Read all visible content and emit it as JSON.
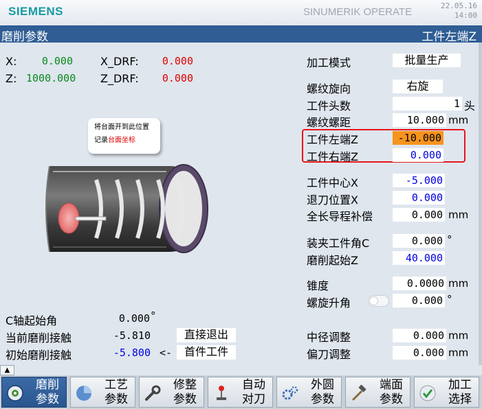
{
  "header": {
    "brand": "SIEMENS",
    "product": "SINUMERIK OPERATE",
    "date": "22.05.16",
    "time": "14:00"
  },
  "titlebar": {
    "left": "磨削参数",
    "right": "工件左端Z"
  },
  "axes": {
    "x_label": "X:",
    "x_value": "0.000",
    "z_label": "Z:",
    "z_value": "1000.000",
    "xdrf_label": "X_DRF:",
    "xdrf_value": "0.000",
    "zdrf_label": "Z_DRF:",
    "zdrf_value": "0.000"
  },
  "callout": {
    "line1": "将台面开到此位置",
    "line2_prefix": "记录",
    "line2_highlight": "台面坐标"
  },
  "params": {
    "mode_label": "加工模式",
    "mode_value": "批量生产",
    "thread_dir_label": "螺纹旋向",
    "thread_dir_value": "右旋",
    "thread_starts_label": "工件头数",
    "thread_starts_value": "1",
    "thread_starts_unit": "头",
    "pitch_label": "螺纹螺距",
    "pitch_value": "10.000",
    "pitch_unit": "mm",
    "left_end_label": "工件左端Z",
    "left_end_value": "-10.000",
    "right_end_label": "工件右端Z",
    "right_end_value": "0.000",
    "center_x_label": "工件中心X",
    "center_x_value": "-5.000",
    "retract_x_label": "退刀位置X",
    "retract_x_value": "0.000",
    "lead_comp_label": "全长导程补偿",
    "lead_comp_value": "0.000",
    "lead_comp_unit": "mm",
    "clamp_angle_label": "装夹工件角C",
    "clamp_angle_value": "0.000",
    "clamp_angle_unit": "°",
    "grind_start_label": "磨削起始Z",
    "grind_start_value": "40.000",
    "taper_label": "锥度",
    "taper_value": "0.0000",
    "taper_unit": "mm",
    "helix_label": "螺旋升角",
    "helix_value": "0.000",
    "helix_unit": "°",
    "pitch_dia_label": "中径调整",
    "pitch_dia_value": "0.000",
    "pitch_dia_unit": "mm",
    "offset_label": "偏刀调整",
    "offset_value": "0.000",
    "offset_unit": "mm"
  },
  "bottom_left": {
    "c_start_label": "C轴起始角",
    "c_start_value": "0.000",
    "c_start_unit": "°",
    "cur_contact_label": "当前磨削接触",
    "cur_contact_value": "-5.810",
    "exit_button": "直接退出",
    "init_contact_label": "初始磨削接触",
    "init_contact_value": "-5.800",
    "arrow": "<-",
    "first_piece_button": "首件工件"
  },
  "softkeys": [
    {
      "label": "磨削\n参数",
      "icon": "grinding-wheel-icon",
      "active": true
    },
    {
      "label": "工艺\n参数",
      "icon": "pie-chart-icon",
      "active": false
    },
    {
      "label": "修整\n参数",
      "icon": "wrench-icon",
      "active": false
    },
    {
      "label": "自动\n对刀",
      "icon": "joystick-icon",
      "active": false
    },
    {
      "label": "外圆\n参数",
      "icon": "gears-icon",
      "active": false
    },
    {
      "label": "端面\n参数",
      "icon": "hammer-icon",
      "active": false
    },
    {
      "label": "加工\n选择",
      "icon": "checkmark-icon",
      "active": false
    }
  ],
  "colors": {
    "brand": "#179aa3",
    "titlebar": "#2f5d94",
    "highlight_field": "#f7941d",
    "frame": "#e8151b",
    "value_blue": "#0000e0",
    "value_green": "#0a8a1e",
    "value_red": "#e00000"
  }
}
